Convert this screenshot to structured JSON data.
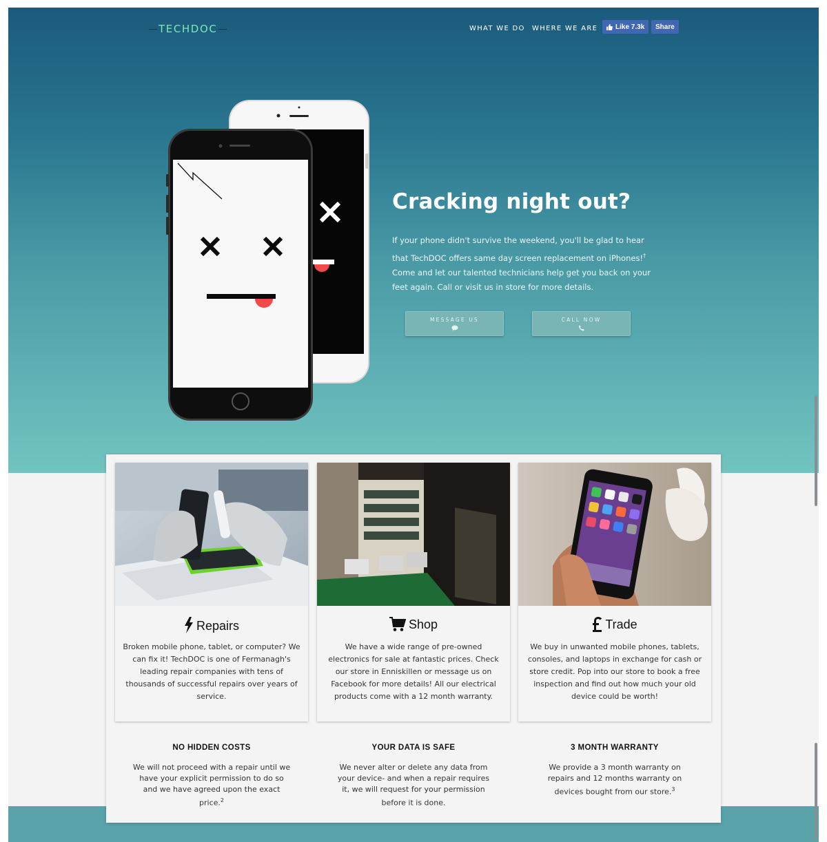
{
  "nav": {
    "logo": "TECHDOC",
    "links": [
      "WHAT WE DO",
      "WHERE WE ARE"
    ],
    "fb_like_label": "Like 7.3k",
    "fb_share_label": "Share"
  },
  "hero": {
    "title": "Cracking night out?",
    "text_part1": "If your phone didn't survive the weekend, you'll be glad to hear that TechDOC offers same day screen replacement on iPhones!",
    "text_sup": "†",
    "text_part2": " Come and let our talented technicians help get you back on your feet again. Call or visit us in store for more details.",
    "buttons": [
      {
        "label": "MESSAGE US",
        "icon": "chat-icon"
      },
      {
        "label": "CALL NOW",
        "icon": "phone-icon"
      }
    ]
  },
  "cards": [
    {
      "title": "Repairs",
      "icon": "lightning-icon",
      "image": "technician-repairing-phone-photo",
      "body": "Broken mobile phone, tablet, or computer? We can fix it! TechDOC is one of Fermanagh's leading repair companies with tens of thousands of successful repairs over years of service."
    },
    {
      "title": "Shop",
      "icon": "shopping-cart-icon",
      "image": "store-interior-photo",
      "body": "We have a wide range of pre-owned electronics for sale at fantastic prices. Check our store in Enniskillen or message us on Facebook for more details! All our electrical products come with a 12 month warranty."
    },
    {
      "title": "Trade",
      "icon": "pound-sign-icon",
      "image": "hand-holding-iphone-photo",
      "body": "We buy in unwanted mobile phones, tablets, consoles, and laptops in exchange for cash or store credit. Pop into our store to book a free inspection and find out how much your old device could be worth!"
    }
  ],
  "features": [
    {
      "title": "NO HIDDEN COSTS",
      "text": "We will not proceed with a repair until we have your explicit permission to do so and we have agreed upon the exact price.",
      "sup": "2"
    },
    {
      "title": "YOUR DATA IS SAFE",
      "text": "We never alter or delete any data from your device- and when a repair requires it, we will request for your permission before it is done.",
      "sup": ""
    },
    {
      "title": "3 MONTH WARRANTY",
      "text": "We provide a 3 month warranty on repairs and 12 months warranty on devices bought from our store.",
      "sup": "3"
    }
  ],
  "colors": {
    "hero_top": "#1b5a7c",
    "hero_bottom": "#72c4c0",
    "logo": "#7ce8b8",
    "facebook": "#4267b2",
    "cta_button": "#78b5b4"
  }
}
